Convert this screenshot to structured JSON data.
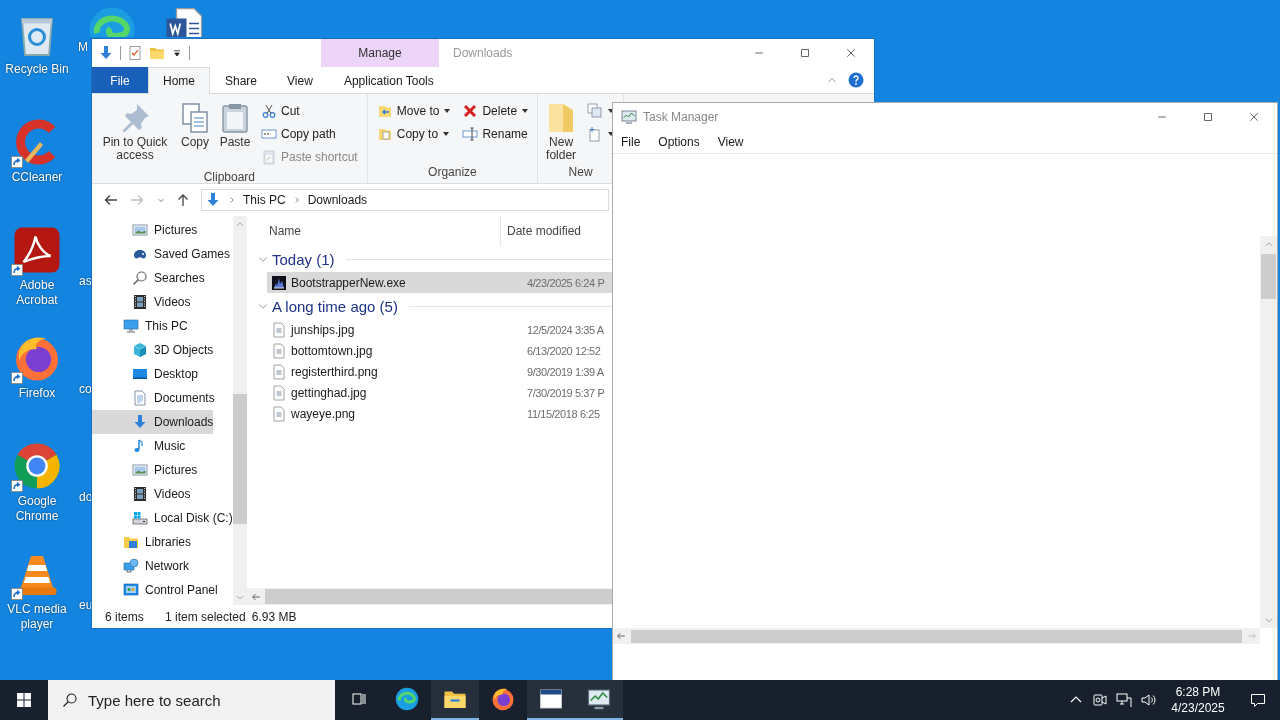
{
  "desktop": {
    "icons": [
      {
        "label": "Recycle Bin",
        "kind": "recycle",
        "shortcut": false
      },
      {
        "label": "CCleaner",
        "kind": "ccleaner",
        "shortcut": true
      },
      {
        "label": "Adobe Acrobat",
        "kind": "acrobat",
        "shortcut": true
      },
      {
        "label": "Firefox",
        "kind": "firefox",
        "shortcut": true
      },
      {
        "label": "Google Chrome",
        "kind": "chrome",
        "shortcut": true
      },
      {
        "label": "VLC media player",
        "kind": "vlc",
        "shortcut": true
      }
    ],
    "second_column": {
      "kind": "edge",
      "label": "M"
    },
    "partial_labels": [
      "as",
      "co",
      "do",
      "eu"
    ],
    "third_column": {
      "kind": "word"
    }
  },
  "explorer": {
    "title": "Downloads",
    "context_group": "Manage",
    "tabs": [
      {
        "label": "File",
        "kind": "file",
        "selected": false
      },
      {
        "label": "Home",
        "kind": "normal",
        "selected": true
      },
      {
        "label": "Share",
        "kind": "normal",
        "selected": false
      },
      {
        "label": "View",
        "kind": "normal",
        "selected": false
      },
      {
        "label": "Application Tools",
        "kind": "contextual",
        "selected": false
      }
    ],
    "ribbon": [
      {
        "label": "Clipboard",
        "columns": [
          {
            "kind": "large",
            "label": "Pin to Quick access"
          },
          {
            "kind": "large",
            "label": "Copy"
          },
          {
            "kind": "large",
            "label": "Paste"
          },
          {
            "kind": "stack",
            "items": [
              {
                "label": "Cut",
                "disabled": false,
                "dropdown": false
              },
              {
                "label": "Copy path",
                "disabled": false,
                "dropdown": false
              },
              {
                "label": "Paste shortcut",
                "disabled": true,
                "dropdown": false
              }
            ]
          }
        ]
      },
      {
        "label": "Organize",
        "columns": [
          {
            "kind": "stack",
            "items": [
              {
                "label": "Move to",
                "disabled": false,
                "dropdown": true
              },
              {
                "label": "Copy to",
                "disabled": false,
                "dropdown": true
              }
            ]
          },
          {
            "kind": "stack",
            "items": [
              {
                "label": "Delete",
                "disabled": false,
                "dropdown": true
              },
              {
                "label": "Rename",
                "disabled": false,
                "dropdown": false
              }
            ]
          }
        ]
      },
      {
        "label": "New",
        "columns": [
          {
            "kind": "large",
            "label": "New folder"
          },
          {
            "kind": "stack",
            "items": [
              {
                "disabled": false,
                "dropdown": true
              },
              {
                "disabled": false,
                "dropdown": true
              }
            ]
          }
        ]
      }
    ],
    "address": [
      "This PC",
      "Downloads"
    ],
    "nav_pane": [
      {
        "kind": "group",
        "children": [
          {
            "label": "Pictures",
            "kind": "pictures",
            "selected": false
          },
          {
            "label": "Saved Games",
            "kind": "savedgames",
            "selected": false
          },
          {
            "label": "Searches",
            "kind": "search",
            "selected": false
          },
          {
            "label": "Videos",
            "kind": "videos",
            "selected": false
          }
        ]
      },
      {
        "label": "This PC",
        "kind": "thispc",
        "selected": false,
        "children": [
          {
            "label": "3D Objects",
            "kind": "cube",
            "selected": false
          },
          {
            "label": "Desktop",
            "kind": "desktop",
            "selected": false
          },
          {
            "label": "Documents",
            "kind": "documents",
            "selected": false
          },
          {
            "label": "Downloads",
            "kind": "download",
            "selected": true
          },
          {
            "label": "Music",
            "kind": "music",
            "selected": false
          },
          {
            "label": "Pictures",
            "kind": "pictures",
            "selected": false
          },
          {
            "label": "Videos",
            "kind": "videos",
            "selected": false
          },
          {
            "label": "Local Disk (C:)",
            "kind": "localdisk",
            "selected": false
          }
        ]
      },
      {
        "label": "Libraries",
        "kind": "libraries",
        "selected": false
      },
      {
        "label": "Network",
        "kind": "network",
        "selected": false
      },
      {
        "label": "Control Panel",
        "kind": "controlpanel",
        "selected": false
      }
    ],
    "columns": [
      "Name",
      "Date modified"
    ],
    "groups": [
      {
        "label": "Today (1)",
        "expanded": true,
        "files": [
          {
            "name": "BootstrapperNew.exe",
            "kind": "exe",
            "date": "4/23/2025 6:24 P",
            "selected": true
          }
        ]
      },
      {
        "label": "A long time ago (5)",
        "expanded": true,
        "files": [
          {
            "name": "junships.jpg",
            "kind": "file",
            "date": "12/5/2024 3:35 A",
            "selected": false
          },
          {
            "name": "bottomtown.jpg",
            "kind": "file",
            "date": "6/13/2020 12:52",
            "selected": false
          },
          {
            "name": "registerthird.png",
            "kind": "file",
            "date": "9/30/2019 1:39 A",
            "selected": false
          },
          {
            "name": "gettinghad.jpg",
            "kind": "file",
            "date": "7/30/2019 5:37 P",
            "selected": false
          },
          {
            "name": "wayeye.png",
            "kind": "file",
            "date": "11/15/2018 6:25",
            "selected": false
          }
        ]
      }
    ],
    "status": {
      "count": "6 items",
      "selection": "1 item selected",
      "size": "6.93 MB"
    }
  },
  "task_manager": {
    "title": "Task Manager",
    "menu": [
      "File",
      "Options",
      "View"
    ]
  },
  "taskbar": {
    "search_placeholder": "Type here to search",
    "apps": [
      {
        "kind": "taskview",
        "running": false
      },
      {
        "kind": "edge",
        "running": false
      },
      {
        "kind": "explorer",
        "running": true
      },
      {
        "kind": "firefox",
        "running": false
      },
      {
        "kind": "window",
        "running": true
      },
      {
        "kind": "taskmgr",
        "running": true
      }
    ],
    "time": "6:28 PM",
    "date": "4/23/2025"
  }
}
